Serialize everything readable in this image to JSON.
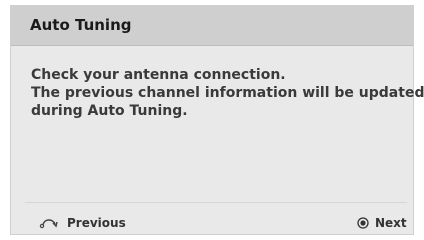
{
  "dialog": {
    "title": "Auto Tuning",
    "message": [
      "Check your antenna connection.",
      "The previous channel information will be updated",
      "during Auto Tuning."
    ]
  },
  "footer": {
    "previous": {
      "label": "Previous",
      "icon": "return-icon"
    },
    "next": {
      "label": "Next",
      "icon": "enter-button-icon"
    }
  },
  "colors": {
    "header_bg": "#cfcfcf",
    "body_bg": "#e9e9e9",
    "text": "#2a2a2a"
  }
}
